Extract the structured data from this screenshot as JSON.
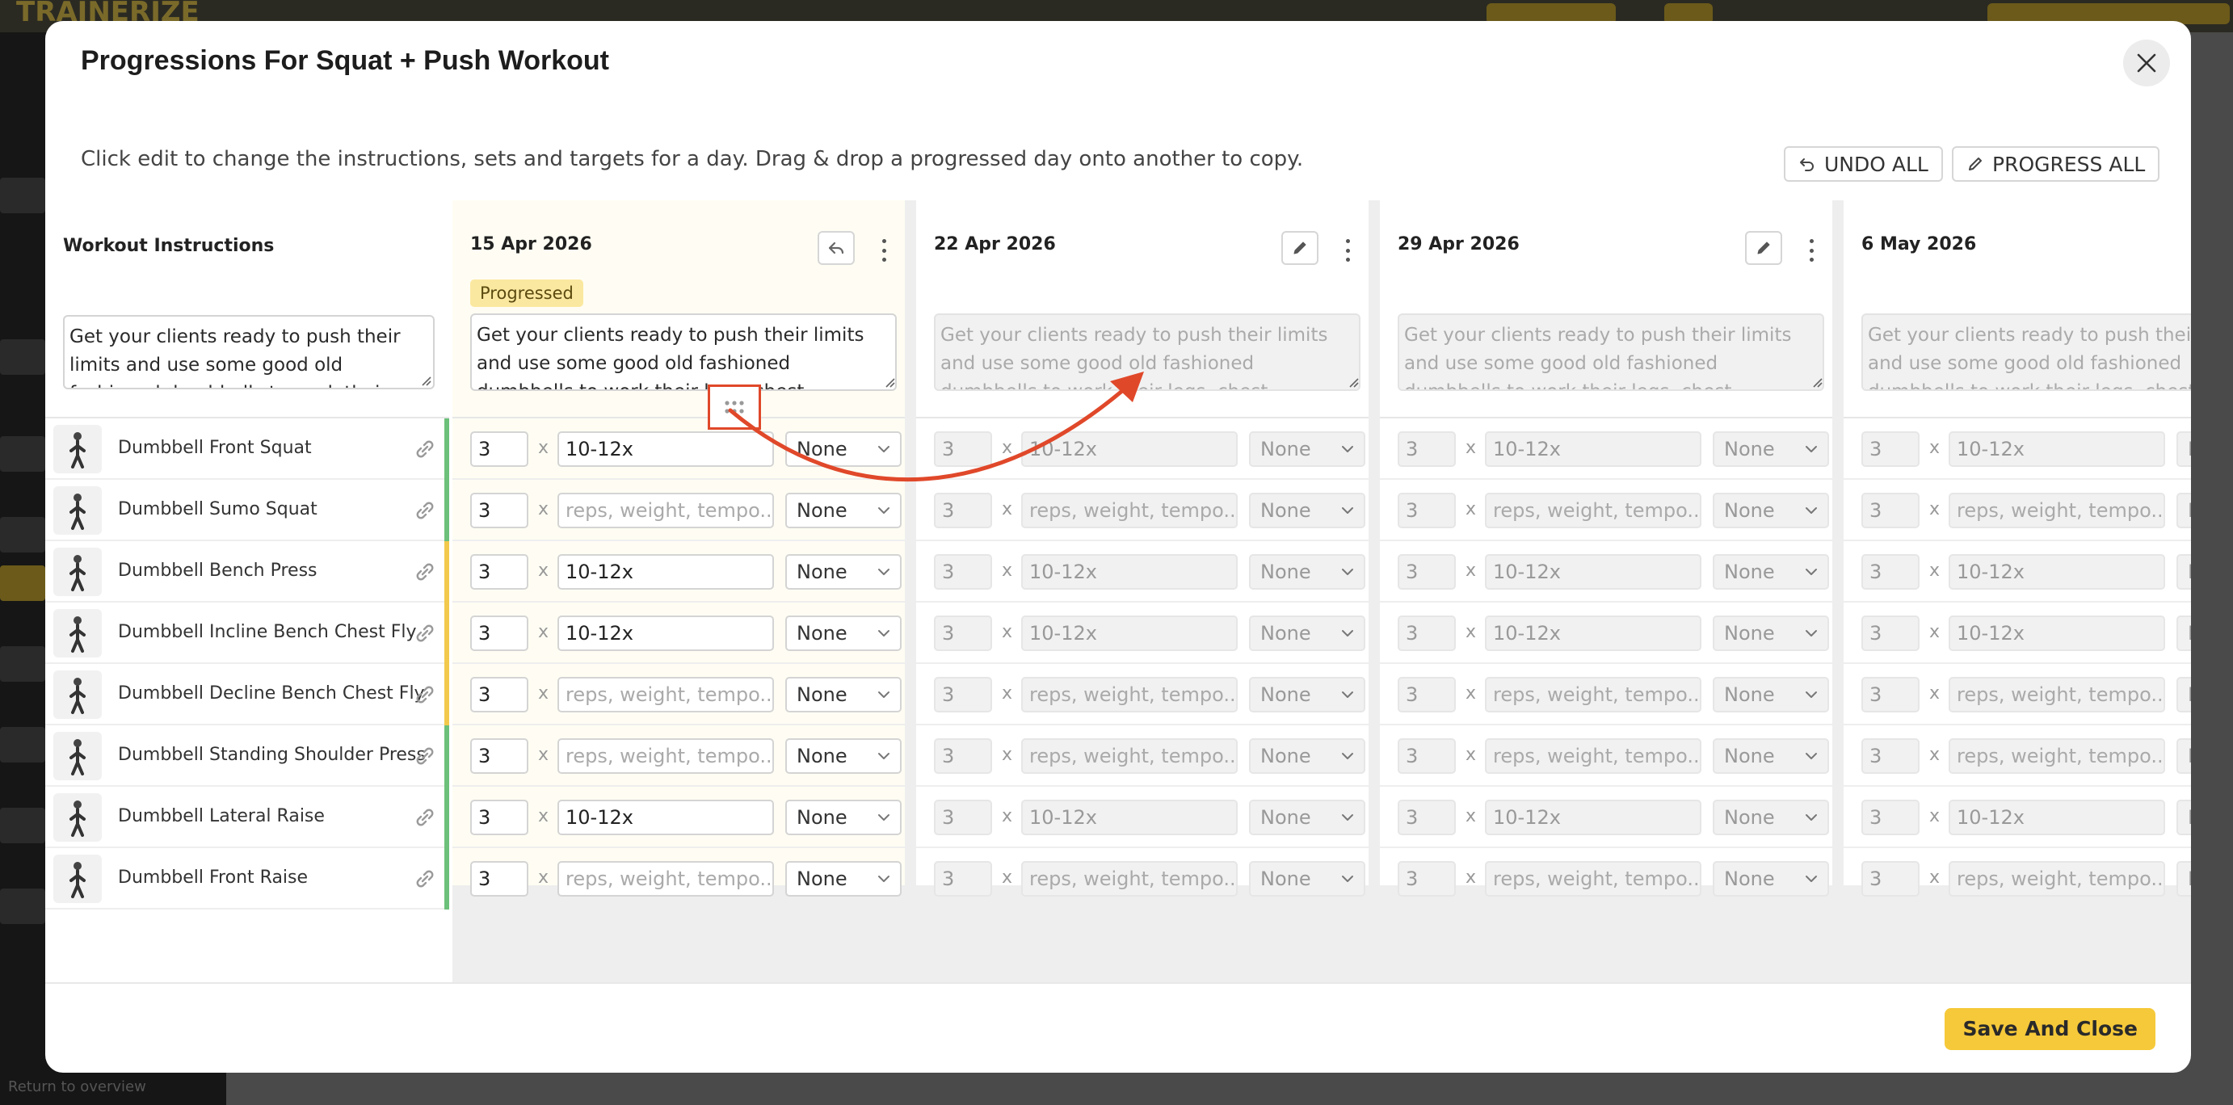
{
  "background": {
    "logo": "TRAINERIZE",
    "return_link": "Return to overview"
  },
  "modal": {
    "title": "Progressions For Squat + Push Workout",
    "hint": "Click edit to change the instructions, sets and targets for a day. Drag & drop a progressed day onto another to copy.",
    "undo_all": "UNDO ALL",
    "progress_all": "PROGRESS ALL",
    "save_and_close": "Save And Close",
    "close_icon": "close-icon"
  },
  "instructions": {
    "title": "Workout Instructions",
    "text": "Get your clients ready to push their limits and use some good old fashioned dumbbells to work their legs, chest, shoulders, and triceps."
  },
  "exercises": [
    {
      "name": "Dumbbell Front Squat",
      "color": "#6cc07a"
    },
    {
      "name": "Dumbbell Sumo Squat",
      "color": "#6cc07a"
    },
    {
      "name": "Dumbbell Bench Press",
      "color": "#f2c94c"
    },
    {
      "name": "Dumbbell Incline Bench Chest Fly",
      "color": "#f2c94c"
    },
    {
      "name": "Dumbbell Decline Bench Chest Fly",
      "color": "#f2c94c"
    },
    {
      "name": "Dumbbell Standing Shoulder Press",
      "color": "#6cc07a"
    },
    {
      "name": "Dumbbell Lateral Raise",
      "color": "#6cc07a"
    },
    {
      "name": "Dumbbell Front Raise",
      "color": "#6cc07a"
    }
  ],
  "days": [
    {
      "date": "15 Apr 2026",
      "badge": "Progressed",
      "text": "Get your clients ready to push their limits and use some good old fashioned dumbbells to work their legs, chest, shoulders, and triceps.",
      "rows": [
        {
          "sets": "3",
          "reps": "10-12x",
          "rest": "None"
        },
        {
          "sets": "3",
          "reps": "reps, weight, tempo...",
          "rest": "None"
        },
        {
          "sets": "3",
          "reps": "10-12x",
          "rest": "None"
        },
        {
          "sets": "3",
          "reps": "10-12x",
          "rest": "None"
        },
        {
          "sets": "3",
          "reps": "reps, weight, tempo...",
          "rest": "None"
        },
        {
          "sets": "3",
          "reps": "reps, weight, tempo...",
          "rest": "None"
        },
        {
          "sets": "3",
          "reps": "10-12x",
          "rest": "None"
        },
        {
          "sets": "3",
          "reps": "reps, weight, tempo...",
          "rest": "None"
        }
      ]
    },
    {
      "date": "22 Apr 2026",
      "text": "Get your clients ready to push their limits and use some good old fashioned dumbbells to work their legs, chest, shoulders, and triceps.",
      "rows": [
        {
          "sets": "3",
          "reps": "10-12x",
          "rest": "None"
        },
        {
          "sets": "3",
          "reps": "reps, weight, tempo...",
          "rest": "None"
        },
        {
          "sets": "3",
          "reps": "10-12x",
          "rest": "None"
        },
        {
          "sets": "3",
          "reps": "10-12x",
          "rest": "None"
        },
        {
          "sets": "3",
          "reps": "reps, weight, tempo...",
          "rest": "None"
        },
        {
          "sets": "3",
          "reps": "reps, weight, tempo...",
          "rest": "None"
        },
        {
          "sets": "3",
          "reps": "10-12x",
          "rest": "None"
        },
        {
          "sets": "3",
          "reps": "reps, weight, tempo...",
          "rest": "None"
        }
      ]
    },
    {
      "date": "29 Apr 2026",
      "text": "Get your clients ready to push their limits and use some good old fashioned dumbbells to work their legs, chest, shoulders, and triceps.",
      "rows": [
        {
          "sets": "3",
          "reps": "10-12x",
          "rest": "None"
        },
        {
          "sets": "3",
          "reps": "reps, weight, tempo...",
          "rest": "None"
        },
        {
          "sets": "3",
          "reps": "10-12x",
          "rest": "None"
        },
        {
          "sets": "3",
          "reps": "10-12x",
          "rest": "None"
        },
        {
          "sets": "3",
          "reps": "reps, weight, tempo...",
          "rest": "None"
        },
        {
          "sets": "3",
          "reps": "reps, weight, tempo...",
          "rest": "None"
        },
        {
          "sets": "3",
          "reps": "10-12x",
          "rest": "None"
        },
        {
          "sets": "3",
          "reps": "reps, weight, tempo...",
          "rest": "None"
        }
      ]
    },
    {
      "date": "6 May 2026",
      "text": "Get your clients ready to push their limits and use some good old fashioned dumbbells to work their legs, chest, shoulders, and triceps.",
      "rows": [
        {
          "sets": "3",
          "reps": "10-12x",
          "rest": "N"
        },
        {
          "sets": "3",
          "reps": "reps, weight, tempo...",
          "rest": "N"
        },
        {
          "sets": "3",
          "reps": "10-12x",
          "rest": "N"
        },
        {
          "sets": "3",
          "reps": "10-12x",
          "rest": "N"
        },
        {
          "sets": "3",
          "reps": "reps, weight, tempo...",
          "rest": "N"
        },
        {
          "sets": "3",
          "reps": "reps, weight, tempo...",
          "rest": "N"
        },
        {
          "sets": "3",
          "reps": "10-12x",
          "rest": "N"
        },
        {
          "sets": "3",
          "reps": "reps, weight, tempo...",
          "rest": "N"
        }
      ]
    }
  ]
}
